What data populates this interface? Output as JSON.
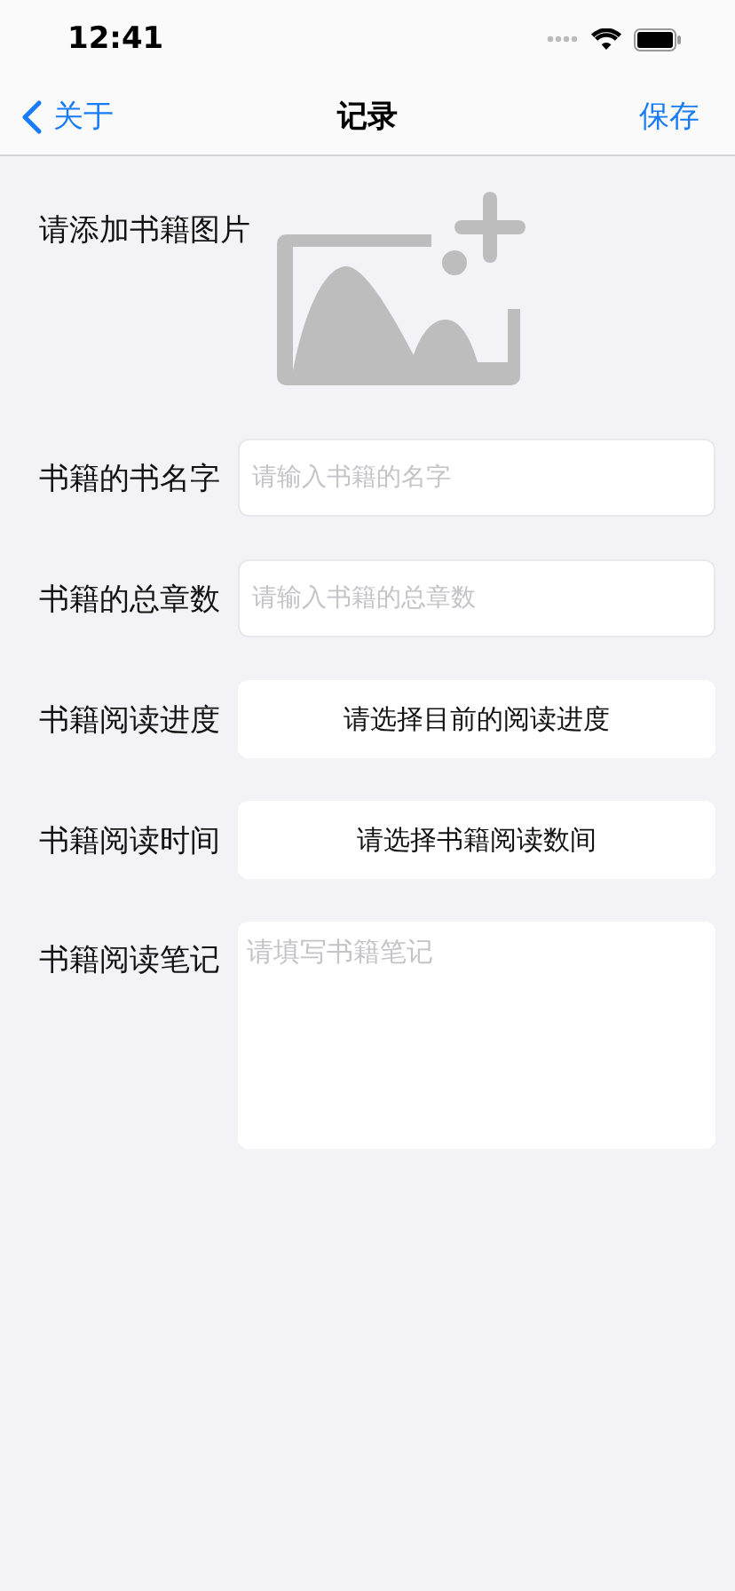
{
  "status_bar": {
    "time": "12:41"
  },
  "nav": {
    "back": "关于",
    "title": "记录",
    "action": "保存"
  },
  "image_picker": {
    "label": "请添加书籍图片"
  },
  "fields": [
    {
      "kind": "input",
      "label": "书籍的书名字",
      "placeholder": "请输入书籍的名字"
    },
    {
      "kind": "input",
      "label": "书籍的总章数",
      "placeholder": "请输入书籍的总章数"
    },
    {
      "kind": "picker",
      "label": "书籍阅读进度",
      "value": "请选择目前的阅读进度"
    },
    {
      "kind": "picker",
      "label": "书籍阅读时间",
      "value": "请选择书籍阅读数间"
    },
    {
      "kind": "textarea",
      "label": "书籍阅读笔记",
      "placeholder": "请填写书籍笔记"
    }
  ]
}
